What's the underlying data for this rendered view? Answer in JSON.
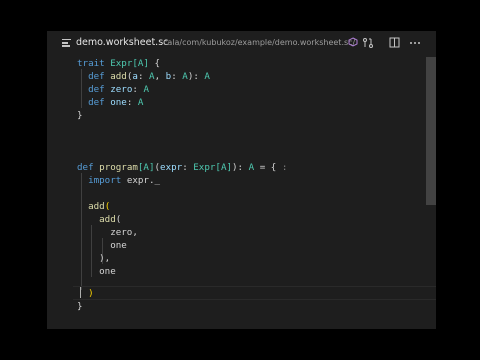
{
  "tab": {
    "filename": "demo.worksheet.sc",
    "path": "cala/com/kubukoz/example/demo.worksheet.sc/"
  },
  "code": {
    "l1_kw": "trait",
    "l1_ty": "Expr",
    "l1_tp": "[A]",
    "l1_tail": " {",
    "l2_kw": "def",
    "l2_fn": "add",
    "l2_a": "a",
    "l2_b": "b",
    "l2_A": "A",
    "l3_kw": "def",
    "l3_fn": "zero",
    "l3_A": "A",
    "l4_kw": "def",
    "l4_fn": "one",
    "l4_A": "A",
    "l5": "}",
    "l7_kw": "def",
    "l7_fn": "program",
    "l7_tp": "[A]",
    "l7_p": "expr",
    "l7_ty": "Expr",
    "l7_tp2": "[A]",
    "l7_A": "A",
    "l7_tail": " = {",
    "l8_kw": "import",
    "l8_rest": " expr._",
    "l10_fn": "add",
    "l11_fn": "add",
    "l12": "zero,",
    "l13": "one",
    "l14": "),",
    "l15": "one",
    "l16": ")",
    "l17": "}"
  }
}
